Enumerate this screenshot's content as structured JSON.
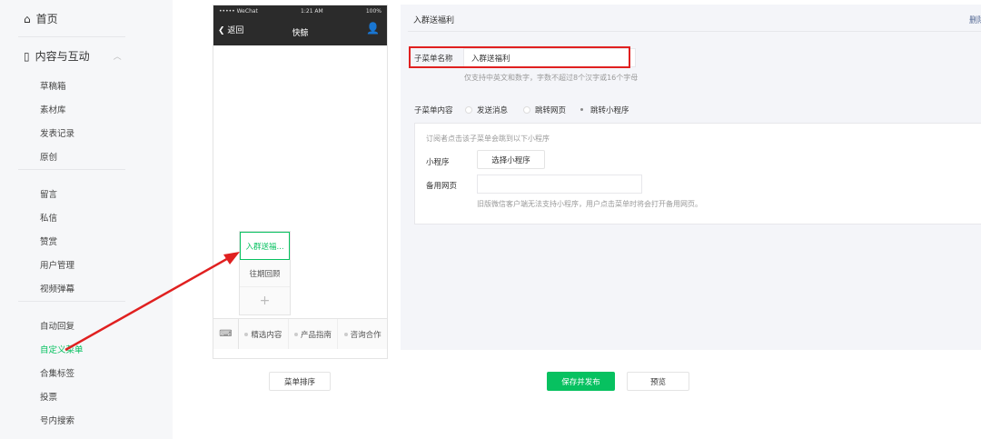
{
  "sidebar": {
    "home": "首页",
    "section": "内容与互动",
    "groups": [
      [
        "草稿箱",
        "素材库",
        "发表记录",
        "原创"
      ],
      [
        "留言",
        "私信",
        "赞赏",
        "用户管理",
        "视频弹幕"
      ],
      [
        "自动回复",
        "自定义菜单",
        "合集标签",
        "投票",
        "号内搜索"
      ]
    ],
    "active": "自定义菜单"
  },
  "phone": {
    "carrier": "••••• WeChat",
    "time": "1:21 AM",
    "battery": "100%",
    "back": "返回",
    "title": "快鲸",
    "submenu": [
      "入群送福...",
      "往期回顾"
    ],
    "add": "+",
    "menus": [
      "精选内容",
      "产品指南",
      "咨询合作"
    ]
  },
  "panel": {
    "header": "入群送福利",
    "delete": "删除",
    "name_label": "子菜单名称",
    "name_value": "入群送福利",
    "name_hint": "仅支持中英文和数字，字数不超过8个汉字或16个字母",
    "content_label": "子菜单内容",
    "options": [
      "发送消息",
      "跳转网页",
      "跳转小程序"
    ],
    "selected": "跳转小程序",
    "inner_hint": "订阅者点击该子菜单会跳到以下小程序",
    "mp_label": "小程序",
    "mp_button": "选择小程序",
    "backup_label": "备用网页",
    "backup_value": "",
    "backup_hint": "旧版微信客户端无法支持小程序，用户点击菜单时将会打开备用网页。"
  },
  "footer": {
    "sort": "菜单排序",
    "save": "保存并发布",
    "preview": "预览"
  },
  "colors": {
    "accent": "#07c160",
    "annotation": "#e02020"
  }
}
